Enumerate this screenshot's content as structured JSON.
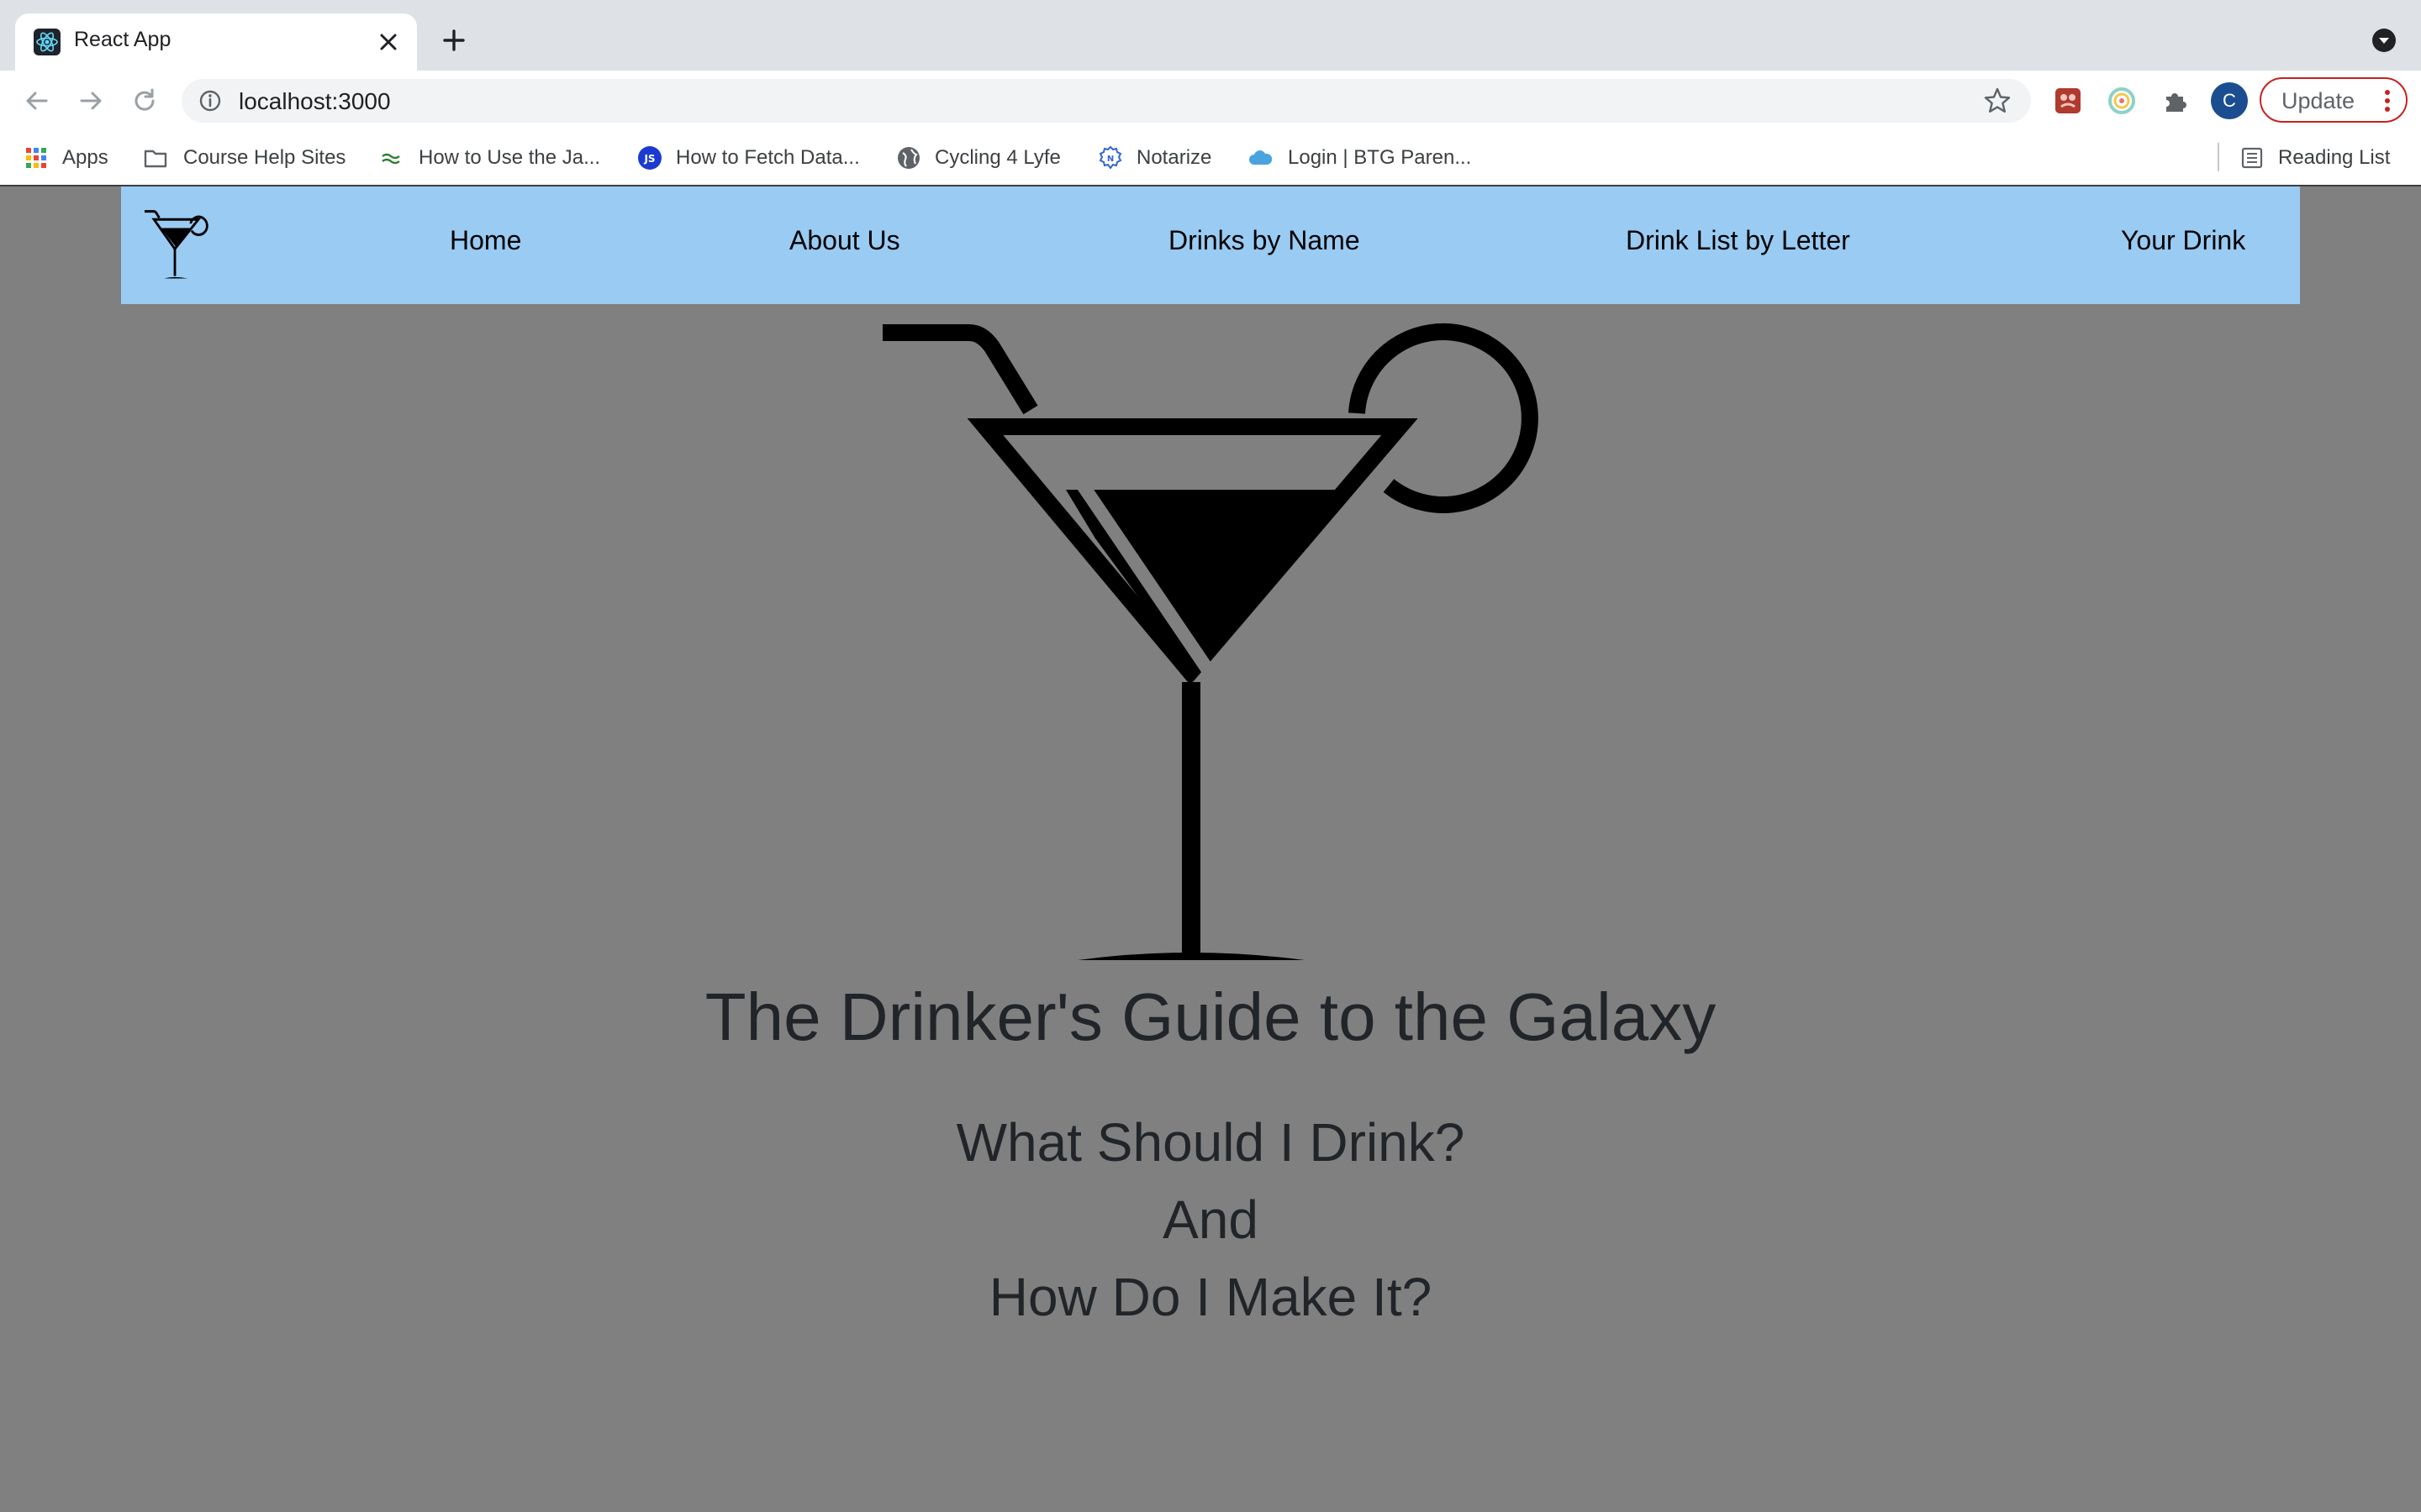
{
  "browser": {
    "tab_title": "React App",
    "url": "localhost:3000",
    "update_label": "Update",
    "profile_initial": "C",
    "bookmarks": [
      {
        "label": "Apps",
        "icon": "apps-grid-icon"
      },
      {
        "label": "Course Help Sites",
        "icon": "folder-icon"
      },
      {
        "label": "How to Use the Ja...",
        "icon": "link-icon"
      },
      {
        "label": "How to Fetch Data...",
        "icon": "js-icon"
      },
      {
        "label": "Cycling 4 Lyfe",
        "icon": "globe-icon"
      },
      {
        "label": "Notarize",
        "icon": "notarize-icon"
      },
      {
        "label": "Login | BTG Paren...",
        "icon": "cloud-icon"
      }
    ],
    "reading_list": "Reading List"
  },
  "navbar": {
    "links": [
      "Home",
      "About Us",
      "Drinks by Name",
      "Drink List by Letter",
      "Your Drink"
    ]
  },
  "hero": {
    "title": "The Drinker's Guide to the Galaxy",
    "subtitle_lines": [
      "What Should I Drink?",
      "And",
      "How Do I Make It?"
    ]
  },
  "colors": {
    "page_background": "#808080",
    "navbar_background": "#99cbf3",
    "heading_text": "#212529",
    "browser_chrome": "#dee1e6",
    "update_border": "#c5221f"
  }
}
